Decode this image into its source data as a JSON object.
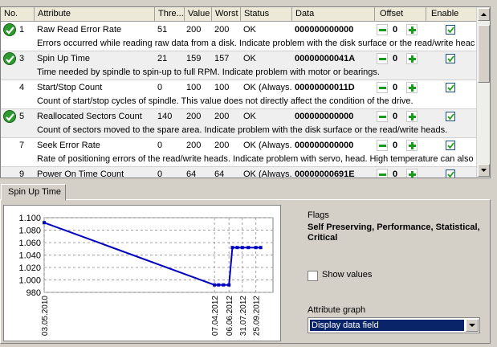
{
  "columns": [
    "No.",
    "Attribute",
    "Thre...",
    "Value",
    "Worst",
    "Status",
    "Data",
    "Offset",
    "Enable"
  ],
  "rows": [
    {
      "no": "1",
      "name": "Raw Read Error Rate",
      "threshold": "51",
      "value": "200",
      "worst": "200",
      "status": "OK",
      "data": "000000000000",
      "offset": "0",
      "ok_icon": true,
      "enabled": true,
      "desc": "Errors occurred while reading raw data from a disk. Indicate problem with the disk surface or the read/write heac"
    },
    {
      "no": "3",
      "name": "Spin Up Time",
      "threshold": "21",
      "value": "159",
      "worst": "157",
      "status": "OK",
      "data": "00000000041A",
      "offset": "0",
      "ok_icon": true,
      "enabled": true,
      "desc": "Time needed by spindle to spin-up to full RPM. Indicate problem with motor or bearings."
    },
    {
      "no": "4",
      "name": "Start/Stop Count",
      "threshold": "0",
      "value": "100",
      "worst": "100",
      "status": "OK (Always...",
      "data": "00000000011D",
      "offset": "0",
      "ok_icon": false,
      "enabled": true,
      "desc": "Count of start/stop cycles of spindle. This value does not directly affect the condition of the drive."
    },
    {
      "no": "5",
      "name": "Reallocated Sectors Count",
      "threshold": "140",
      "value": "200",
      "worst": "200",
      "status": "OK",
      "data": "000000000000",
      "offset": "0",
      "ok_icon": true,
      "enabled": true,
      "desc": "Count of sectors moved to the spare area. Indicate problem with the disk surface or the read/write heads."
    },
    {
      "no": "7",
      "name": "Seek Error Rate",
      "threshold": "0",
      "value": "200",
      "worst": "200",
      "status": "OK (Always...",
      "data": "000000000000",
      "offset": "0",
      "ok_icon": false,
      "enabled": true,
      "desc": "Rate of positioning errors of the read/write heads. Indicate problem with servo, head. High temperature can also c"
    },
    {
      "no": "9",
      "name": "Power On Time Count",
      "threshold": "0",
      "value": "64",
      "worst": "64",
      "status": "OK (Always...",
      "data": "00000000691E",
      "offset": "0",
      "ok_icon": false,
      "enabled": true,
      "desc": ""
    }
  ],
  "tab_label": "Spin Up Time",
  "flags_label": "Flags",
  "flags_value": "Self Preserving, Performance, Statistical, Critical",
  "show_values_label": "Show values",
  "attribute_graph_label": "Attribute graph",
  "attribute_graph_value": "Display data field",
  "colors": {
    "line": "#0000c0",
    "ok": "#2f9a2f",
    "plus": "#1a9a1a",
    "selection": "#0a246a"
  },
  "chart_data": {
    "type": "line",
    "yticks": [
      "1.100",
      "1.080",
      "1.060",
      "1.040",
      "1.020",
      "1.000",
      "980"
    ],
    "ylim": [
      980,
      1100
    ],
    "xticks": [
      "03.05.2010",
      "07.04.2012",
      "06.06.2012",
      "31.07.2012",
      "25.09.2012"
    ],
    "series": [
      {
        "points": [
          [
            "03.05.2010",
            1092
          ],
          [
            "07.04.2012",
            992
          ],
          [
            "24.04.2012",
            992
          ],
          [
            "14.05.2012",
            992
          ],
          [
            "06.06.2012",
            992
          ],
          [
            "20.06.2012",
            1052
          ],
          [
            "10.07.2012",
            1052
          ],
          [
            "31.07.2012",
            1052
          ],
          [
            "25.08.2012",
            1052
          ],
          [
            "25.09.2012",
            1052
          ],
          [
            "15.10.2012",
            1052
          ]
        ]
      }
    ]
  }
}
